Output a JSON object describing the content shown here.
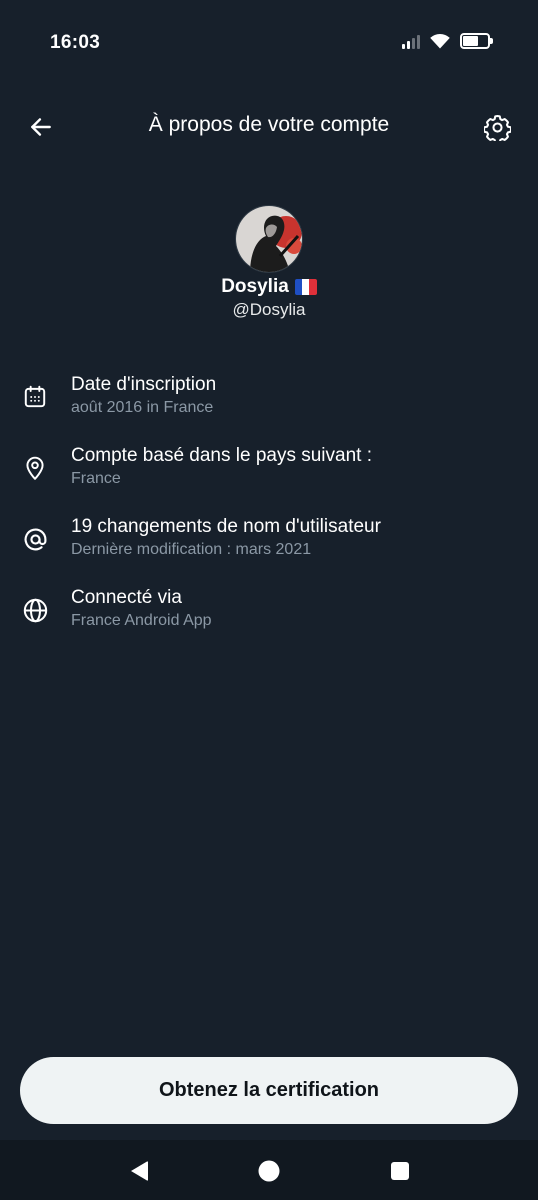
{
  "status_bar": {
    "time": "16:03",
    "battery_level": 0.62
  },
  "header": {
    "title": "À propos de votre compte",
    "back_icon": "arrow-left-icon",
    "settings_icon": "gear-icon"
  },
  "profile": {
    "display_name": "Dosylia",
    "flag": "🇫🇷",
    "handle": "@Dosylia"
  },
  "info": [
    {
      "icon": "calendar-icon",
      "title": "Date d'inscription",
      "subtitle": "août 2016 in France"
    },
    {
      "icon": "location-pin-icon",
      "title": "Compte basé dans le pays suivant :",
      "subtitle": "France"
    },
    {
      "icon": "at-sign-icon",
      "title": "19 changements de nom d'utilisateur",
      "subtitle": "Dernière modification : mars 2021"
    },
    {
      "icon": "globe-icon",
      "title": "Connecté via",
      "subtitle": "France Android App"
    }
  ],
  "cta": {
    "label": "Obtenez la certification"
  },
  "colors": {
    "background": "#17202b",
    "text_primary": "#ffffff",
    "text_secondary": "#8b98a5",
    "button_bg": "#eff3f4",
    "button_text": "#0f1419"
  }
}
